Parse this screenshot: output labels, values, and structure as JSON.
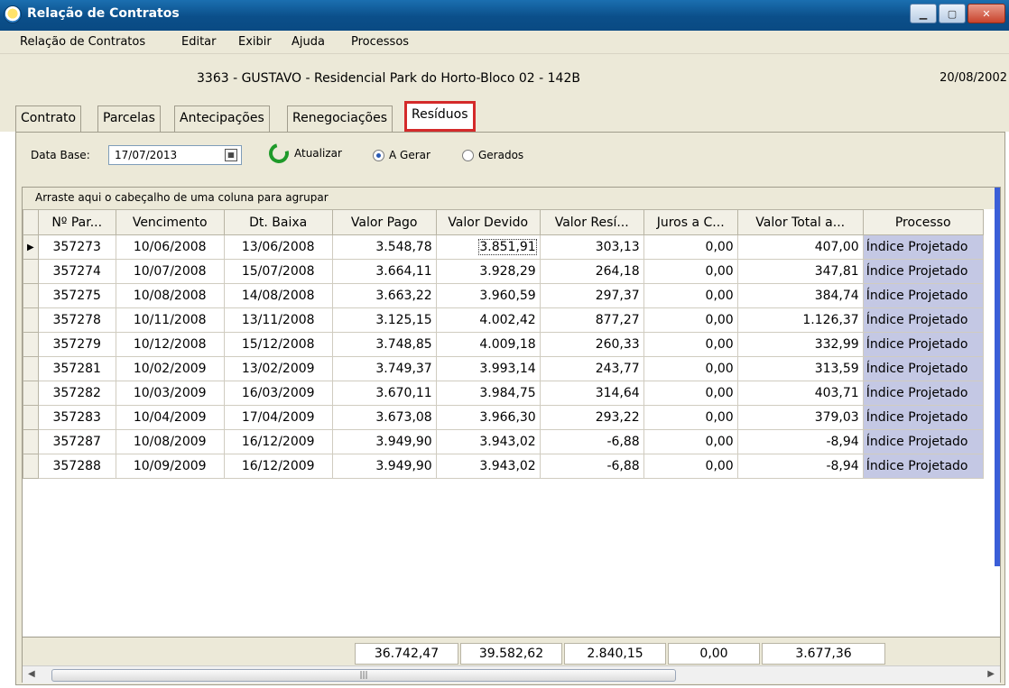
{
  "window": {
    "title": "Relação de Contratos"
  },
  "menu": [
    "Relação de Contratos",
    "Editar",
    "Exibir",
    "Ajuda",
    "Processos"
  ],
  "contract": {
    "info": "3363 - GUSTAVO - Residencial Park do Horto-Bloco 02 - 142B",
    "date": "20/08/2002"
  },
  "tabs": [
    "Contrato",
    "Parcelas",
    "Antecipações",
    "Renegociações",
    "Resíduos"
  ],
  "active_tab": "Resíduos",
  "toolbar": {
    "date_label": "Data Base:",
    "date_value": "17/07/2013",
    "refresh_label": "Atualizar",
    "radio_a_gerar": "A Gerar",
    "radio_gerados": "Gerados",
    "selected_radio": "A Gerar"
  },
  "grid": {
    "group_hint": "Arraste aqui o cabeçalho de uma coluna para agrupar",
    "columns": [
      "Nº Par...",
      "Vencimento",
      "Dt. Baixa",
      "Valor Pago",
      "Valor Devido",
      "Valor Resí...",
      "Juros a C...",
      "Valor Total a...",
      "Processo"
    ],
    "rows": [
      [
        "357273",
        "10/06/2008",
        "13/06/2008",
        "3.548,78",
        "3.851,91",
        "303,13",
        "0,00",
        "407,00",
        "Índice Projetado"
      ],
      [
        "357274",
        "10/07/2008",
        "15/07/2008",
        "3.664,11",
        "3.928,29",
        "264,18",
        "0,00",
        "347,81",
        "Índice Projetado"
      ],
      [
        "357275",
        "10/08/2008",
        "14/08/2008",
        "3.663,22",
        "3.960,59",
        "297,37",
        "0,00",
        "384,74",
        "Índice Projetado"
      ],
      [
        "357278",
        "10/11/2008",
        "13/11/2008",
        "3.125,15",
        "4.002,42",
        "877,27",
        "0,00",
        "1.126,37",
        "Índice Projetado"
      ],
      [
        "357279",
        "10/12/2008",
        "15/12/2008",
        "3.748,85",
        "4.009,18",
        "260,33",
        "0,00",
        "332,99",
        "Índice Projetado"
      ],
      [
        "357281",
        "10/02/2009",
        "13/02/2009",
        "3.749,37",
        "3.993,14",
        "243,77",
        "0,00",
        "313,59",
        "Índice Projetado"
      ],
      [
        "357282",
        "10/03/2009",
        "16/03/2009",
        "3.670,11",
        "3.984,75",
        "314,64",
        "0,00",
        "403,71",
        "Índice Projetado"
      ],
      [
        "357283",
        "10/04/2009",
        "17/04/2009",
        "3.673,08",
        "3.966,30",
        "293,22",
        "0,00",
        "379,03",
        "Índice Projetado"
      ],
      [
        "357287",
        "10/08/2009",
        "16/12/2009",
        "3.949,90",
        "3.943,02",
        "-6,88",
        "0,00",
        "-8,94",
        "Índice Projetado"
      ],
      [
        "357288",
        "10/09/2009",
        "16/12/2009",
        "3.949,90",
        "3.943,02",
        "-6,88",
        "0,00",
        "-8,94",
        "Índice Projetado"
      ]
    ],
    "totals": [
      "36.742,47",
      "39.582,62",
      "2.840,15",
      "0,00",
      "3.677,36"
    ]
  },
  "colors": {
    "titlebar": "#0b4f8a",
    "highlight_tab_border": "#d42a2a",
    "process_cell": "#c4c8e4",
    "refresh_icon": "#1f9a2a"
  },
  "icons": [
    "app-icon",
    "calendar-icon",
    "refresh-icon",
    "scroll-left-icon",
    "scroll-right-icon"
  ]
}
